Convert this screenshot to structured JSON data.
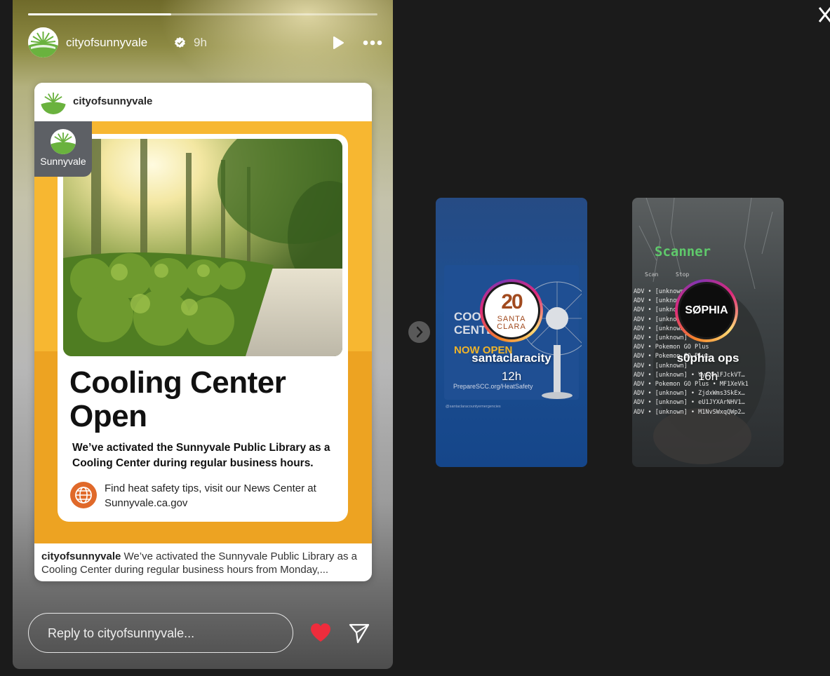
{
  "story": {
    "progress": 0.41,
    "username": "cityofsunnyvale",
    "time": "9h",
    "reply_placeholder": "Reply to cityofsunnyvale..."
  },
  "post": {
    "username": "cityofsunnyvale",
    "brand_name": "Sunnyvale",
    "headline": "Cooling Center Open",
    "subtext": "We’ve activated the Sunnyvale Public Library as a Cooling Center during regular business hours.",
    "tips": "Find heat safety tips, visit our News Center at Sunnyvale.ca.gov",
    "caption_user": "cityofsunnyvale",
    "caption_text": "We’ve activated the Sunnyvale Public Library as a Cooling Center during regular business hours from Monday,..."
  },
  "next_stories": [
    {
      "username": "santaclaracity",
      "time": "12h",
      "logo_number": "20",
      "logo_text": "SANTA CLARA",
      "bg_headline": "COOLING CENTERS",
      "bg_now_open": "NOW OPEN",
      "bg_url": "PrepareSCC.org/HeatSafety",
      "bg_handle": "@santaclaracountyemergencies"
    },
    {
      "username": "s0phia ops",
      "time": "16h",
      "logo_text": "SØPHIA",
      "bg_title": "Scanner",
      "bg_scan": "Scan",
      "bg_stop": "Stop",
      "bg_lines": [
        "ADV • [unknown]",
        "ADV • [unknown]",
        "ADV • [unknown]",
        "ADV • [unknown]",
        "ADV • [unknown]",
        "ADV • [unknown]",
        "ADV • Pokemon GO Plus",
        "ADV • Pokemon GO Plus",
        "ADV • [unknown]",
        "ADV • [unknown] • VytXk1FJckVT…",
        "ADV • Pokemon GO Plus • MF1XeVk1",
        "ADV • [unknown] • ZjdxWms3SkEx…",
        "ADV • [unknown] • eU1JYXArNHV1…",
        "ADV • [unknown] • M1NvSWxqQWp2…"
      ]
    }
  ],
  "colors": {
    "heart": "#ee2c3c",
    "sunnyvale_green": "#6ab23e",
    "graphic_yellow": "#f7b731",
    "globe_orange": "#e0692a"
  },
  "icons": [
    "verified-badge-icon",
    "play-icon",
    "more-icon",
    "globe-icon",
    "heart-icon",
    "send-icon",
    "close-icon",
    "chevron-right-icon"
  ]
}
